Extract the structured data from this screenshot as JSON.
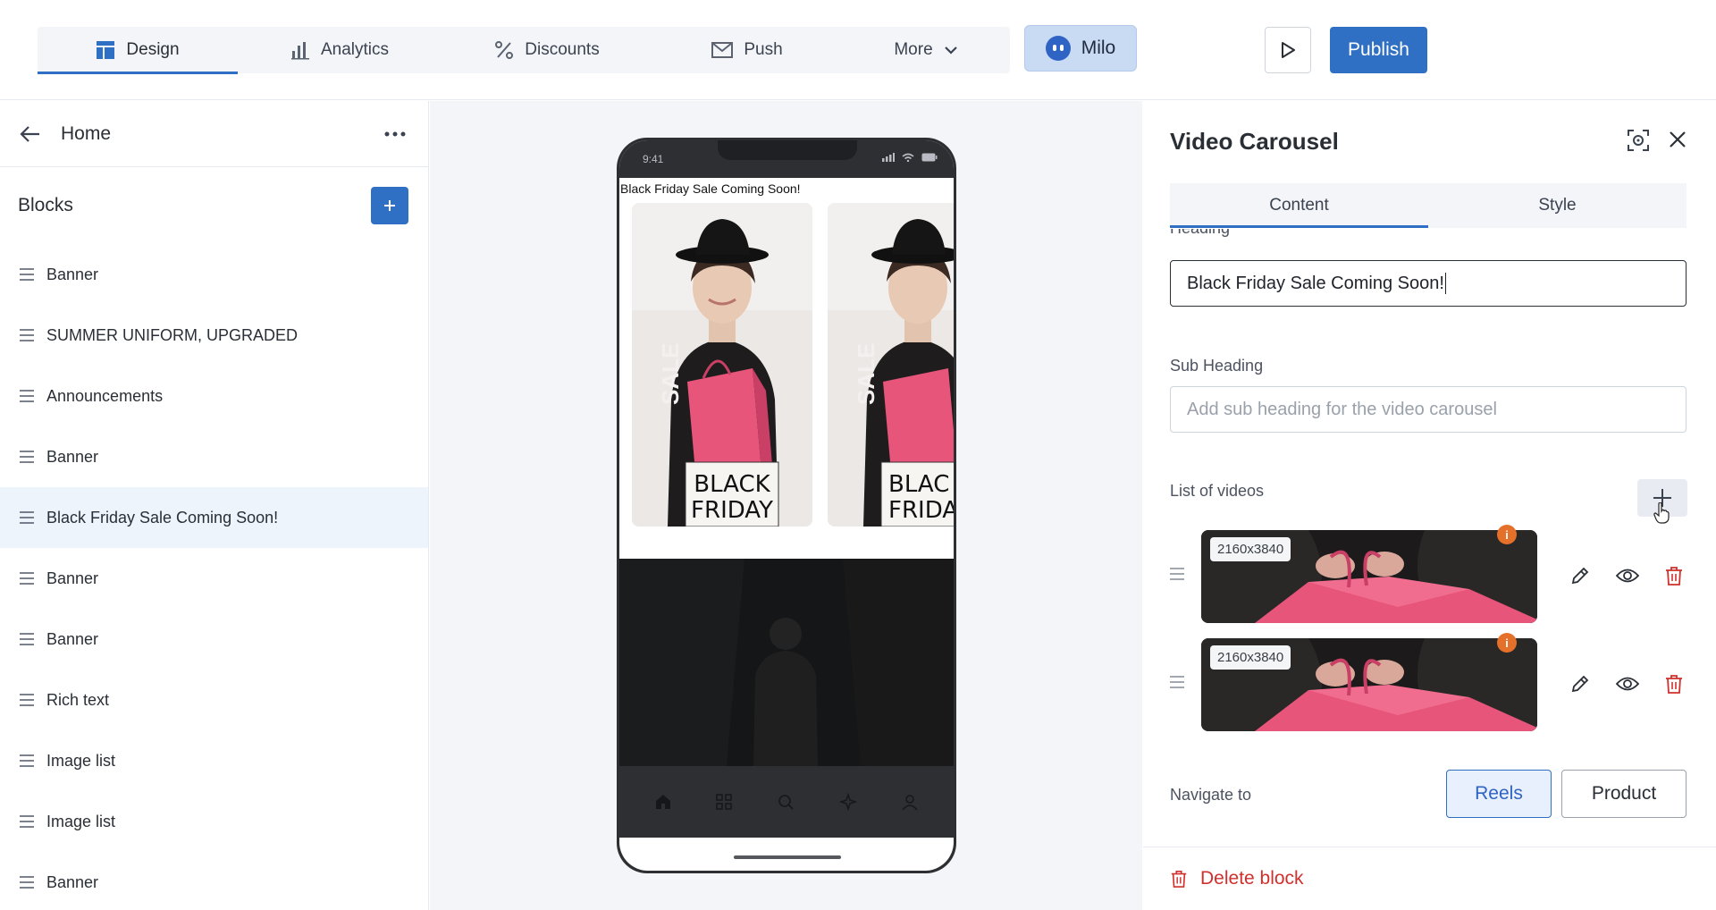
{
  "topbar": {
    "tabs": [
      {
        "label": "Design",
        "icon": "layout-icon"
      },
      {
        "label": "Analytics",
        "icon": "bar-chart-icon"
      },
      {
        "label": "Discounts",
        "icon": "percent-icon"
      },
      {
        "label": "Push",
        "icon": "mail-icon"
      },
      {
        "label": "More",
        "icon": "chevron-down-icon"
      }
    ],
    "milo_label": "Milo",
    "publish_label": "Publish"
  },
  "sidebar": {
    "page_title": "Home",
    "blocks_label": "Blocks",
    "items": [
      {
        "label": "Banner"
      },
      {
        "label": "SUMMER UNIFORM, UPGRADED"
      },
      {
        "label": "Announcements"
      },
      {
        "label": "Banner"
      },
      {
        "label": "Black Friday Sale Coming Soon!"
      },
      {
        "label": "Banner"
      },
      {
        "label": "Banner"
      },
      {
        "label": "Rich text"
      },
      {
        "label": "Image list"
      },
      {
        "label": "Image list"
      },
      {
        "label": "Banner"
      }
    ],
    "selected_item": "Black Friday Sale Coming Soon!"
  },
  "preview": {
    "time": "9:41",
    "heading": "Black Friday Sale Coming Soon!",
    "bag_text": "SALE",
    "sign_text_1": "BLACK",
    "sign_text_2": "FRIDAY",
    "sign2_text_1": "BLAC",
    "sign2_text_2": "FRIDA"
  },
  "panel": {
    "title": "Video Carousel",
    "tabs": {
      "content": "Content",
      "style": "Style"
    },
    "heading_label": "Heading",
    "heading_value": "Black Friday Sale Coming Soon!",
    "subheading_label": "Sub Heading",
    "subheading_placeholder": "Add sub heading for the video carousel",
    "videos_label": "List of videos",
    "videos": [
      {
        "dimensions": "2160x3840",
        "info": "i"
      },
      {
        "dimensions": "2160x3840",
        "info": "i"
      }
    ],
    "navigate_label": "Navigate to",
    "navigate_options": {
      "reels": "Reels",
      "product": "Product"
    },
    "delete_label": "Delete block"
  },
  "colors": {
    "accent": "#2f6fc4",
    "danger": "#d0312d",
    "warning": "#e4702a",
    "selected_bg": "#eef4fc"
  }
}
